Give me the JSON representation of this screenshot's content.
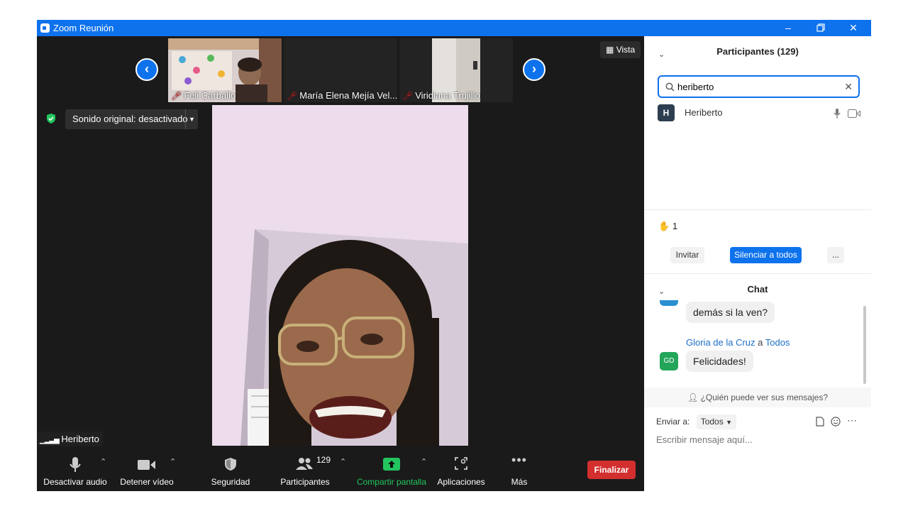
{
  "window": {
    "title": "Zoom Reunión",
    "minimize_icon": "minimize-icon",
    "restore_icon": "restore-icon",
    "close_icon": "close-icon"
  },
  "gallery": {
    "thumbnails": [
      {
        "name": "Feli Carballo",
        "muted": true
      },
      {
        "name": "María Elena Mejía Vel...",
        "muted": true
      },
      {
        "name": "Viridiana Trujillo",
        "muted": true
      }
    ],
    "view_label": "Vista"
  },
  "audio": {
    "original_sound_label": "Sonido original: desactivado"
  },
  "speaker": {
    "name": "Heriberto"
  },
  "toolbar": {
    "mute_label": "Desactivar audio",
    "video_label": "Detener vídeo",
    "security_label": "Seguridad",
    "participants_label": "Participantes",
    "participants_count": "129",
    "share_label": "Compartir pantalla",
    "apps_label": "Aplicaciones",
    "more_label": "Más",
    "end_label": "Finalizar"
  },
  "participants_panel": {
    "title": "Participantes (129)",
    "search_value": "heriberto",
    "results": [
      {
        "initial": "H",
        "name": "Heriberto"
      }
    ],
    "raised_hands": "1",
    "invite_label": "Invitar",
    "mute_all_label": "Silenciar a todos",
    "more_label": "..."
  },
  "chat": {
    "title": "Chat",
    "messages": [
      {
        "text": "demás si la ven?"
      },
      {
        "sender": "Gloria de la Cruz",
        "to_word": "a",
        "recipient": "Todos",
        "initials": "GD",
        "text": "Felicidades!"
      }
    ],
    "who_can_see": "¿Quién puede ver sus mensajes?",
    "send_to_label": "Enviar a:",
    "send_to_value": "Todos",
    "input_placeholder": "Escribir mensaje aquí..."
  },
  "colors": {
    "zoom_blue": "#0e72ed",
    "end_red": "#d32f2f",
    "share_green": "#22c55e",
    "mute_red": "#e02828"
  }
}
